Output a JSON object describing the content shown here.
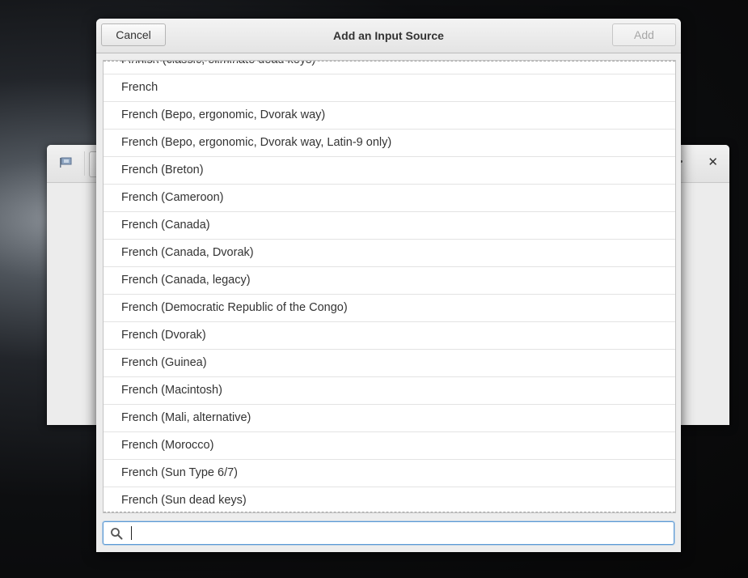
{
  "background_window": {
    "icons": [
      "flag-icon",
      "close-icon"
    ]
  },
  "dialog": {
    "title": "Add an Input Source",
    "cancel_label": "Cancel",
    "add_label": "Add",
    "add_enabled": false
  },
  "list": {
    "items": [
      "Finnish (classic, eliminate dead keys)",
      "French",
      "French (Bepo, ergonomic, Dvorak way)",
      "French (Bepo, ergonomic, Dvorak way, Latin-9 only)",
      "French (Breton)",
      "French (Cameroon)",
      "French (Canada)",
      "French (Canada, Dvorak)",
      "French (Canada, legacy)",
      "French (Democratic Republic of the Congo)",
      "French (Dvorak)",
      "French (Guinea)",
      "French (Macintosh)",
      "French (Mali, alternative)",
      "French (Morocco)",
      "French (Sun Type 6/7)",
      "French (Sun dead keys)"
    ]
  },
  "search": {
    "value": "",
    "icon": "search-icon"
  },
  "colors": {
    "focus_border": "#5b9ad6",
    "disabled_text": "#a6a6a6"
  }
}
